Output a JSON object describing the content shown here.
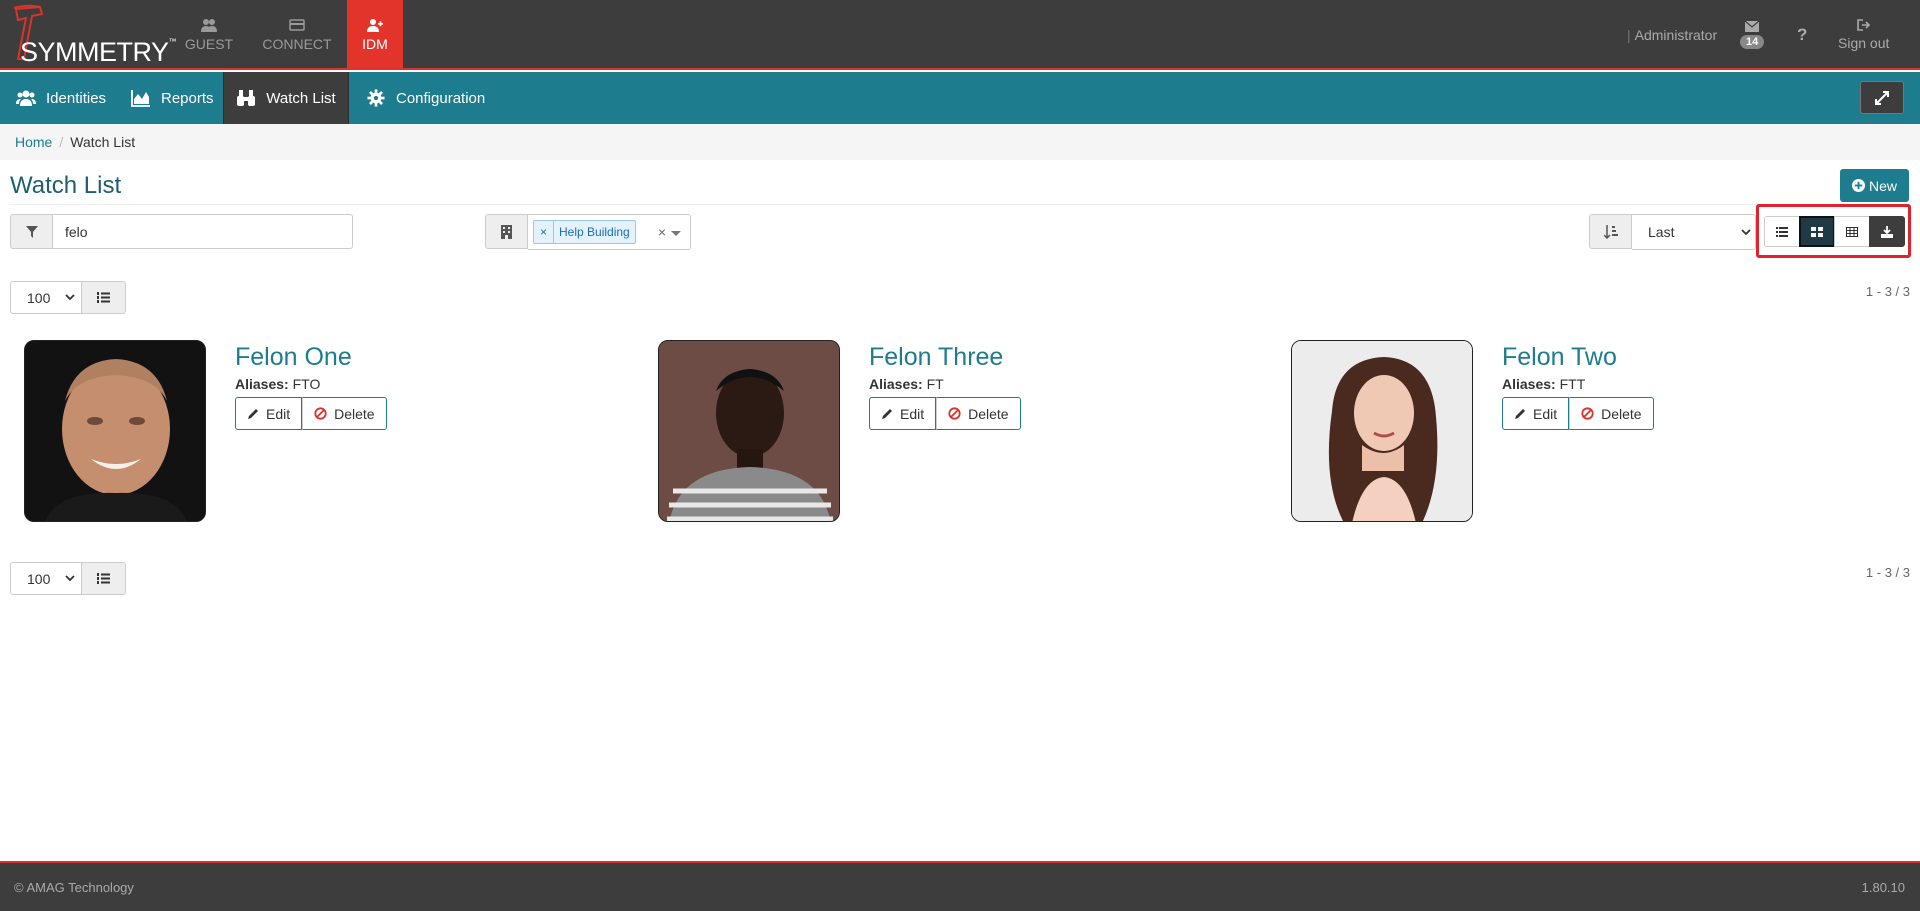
{
  "brand": {
    "name": "SYMMETRY",
    "tm": "™"
  },
  "apps": [
    {
      "label": "GUEST",
      "icon": "users-icon"
    },
    {
      "label": "CONNECT",
      "icon": "card-icon"
    },
    {
      "label": "IDM",
      "icon": "user-plus-icon"
    }
  ],
  "header": {
    "user_sep": "|",
    "user": "Administrator",
    "mail_count": "14",
    "help": "?",
    "signout": "Sign out"
  },
  "nav": {
    "items": [
      {
        "label": "Identities",
        "icon": "users-icon"
      },
      {
        "label": "Reports",
        "icon": "area-chart-icon"
      },
      {
        "label": "Watch List",
        "icon": "binoculars-icon"
      },
      {
        "label": "Configuration",
        "icon": "gear-icon"
      }
    ]
  },
  "breadcrumb": {
    "home": "Home",
    "sep": "/",
    "current": "Watch List"
  },
  "page": {
    "title": "Watch List",
    "new_label": "New"
  },
  "filter": {
    "value": "felo",
    "tag_remove": "×",
    "tag": "Help Building",
    "clear": "×"
  },
  "sort": {
    "value": "Last"
  },
  "pager": {
    "per_page": "100",
    "count": "1 - 3 / 3"
  },
  "cards": [
    {
      "name": "Felon One",
      "aliases_label": "Aliases:",
      "aliases": "FTO",
      "edit": "Edit",
      "delete": "Delete"
    },
    {
      "name": "Felon Three",
      "aliases_label": "Aliases:",
      "aliases": "FT",
      "edit": "Edit",
      "delete": "Delete"
    },
    {
      "name": "Felon Two",
      "aliases_label": "Aliases:",
      "aliases": "FTT",
      "edit": "Edit",
      "delete": "Delete"
    }
  ],
  "footer": {
    "copyright": "© AMAG Technology",
    "version": "1.80.10"
  },
  "colors": {
    "accent": "#1d7c8d",
    "brand_red": "#e2342a",
    "dark": "#3d3d3d",
    "highlight": "#e0242f"
  }
}
